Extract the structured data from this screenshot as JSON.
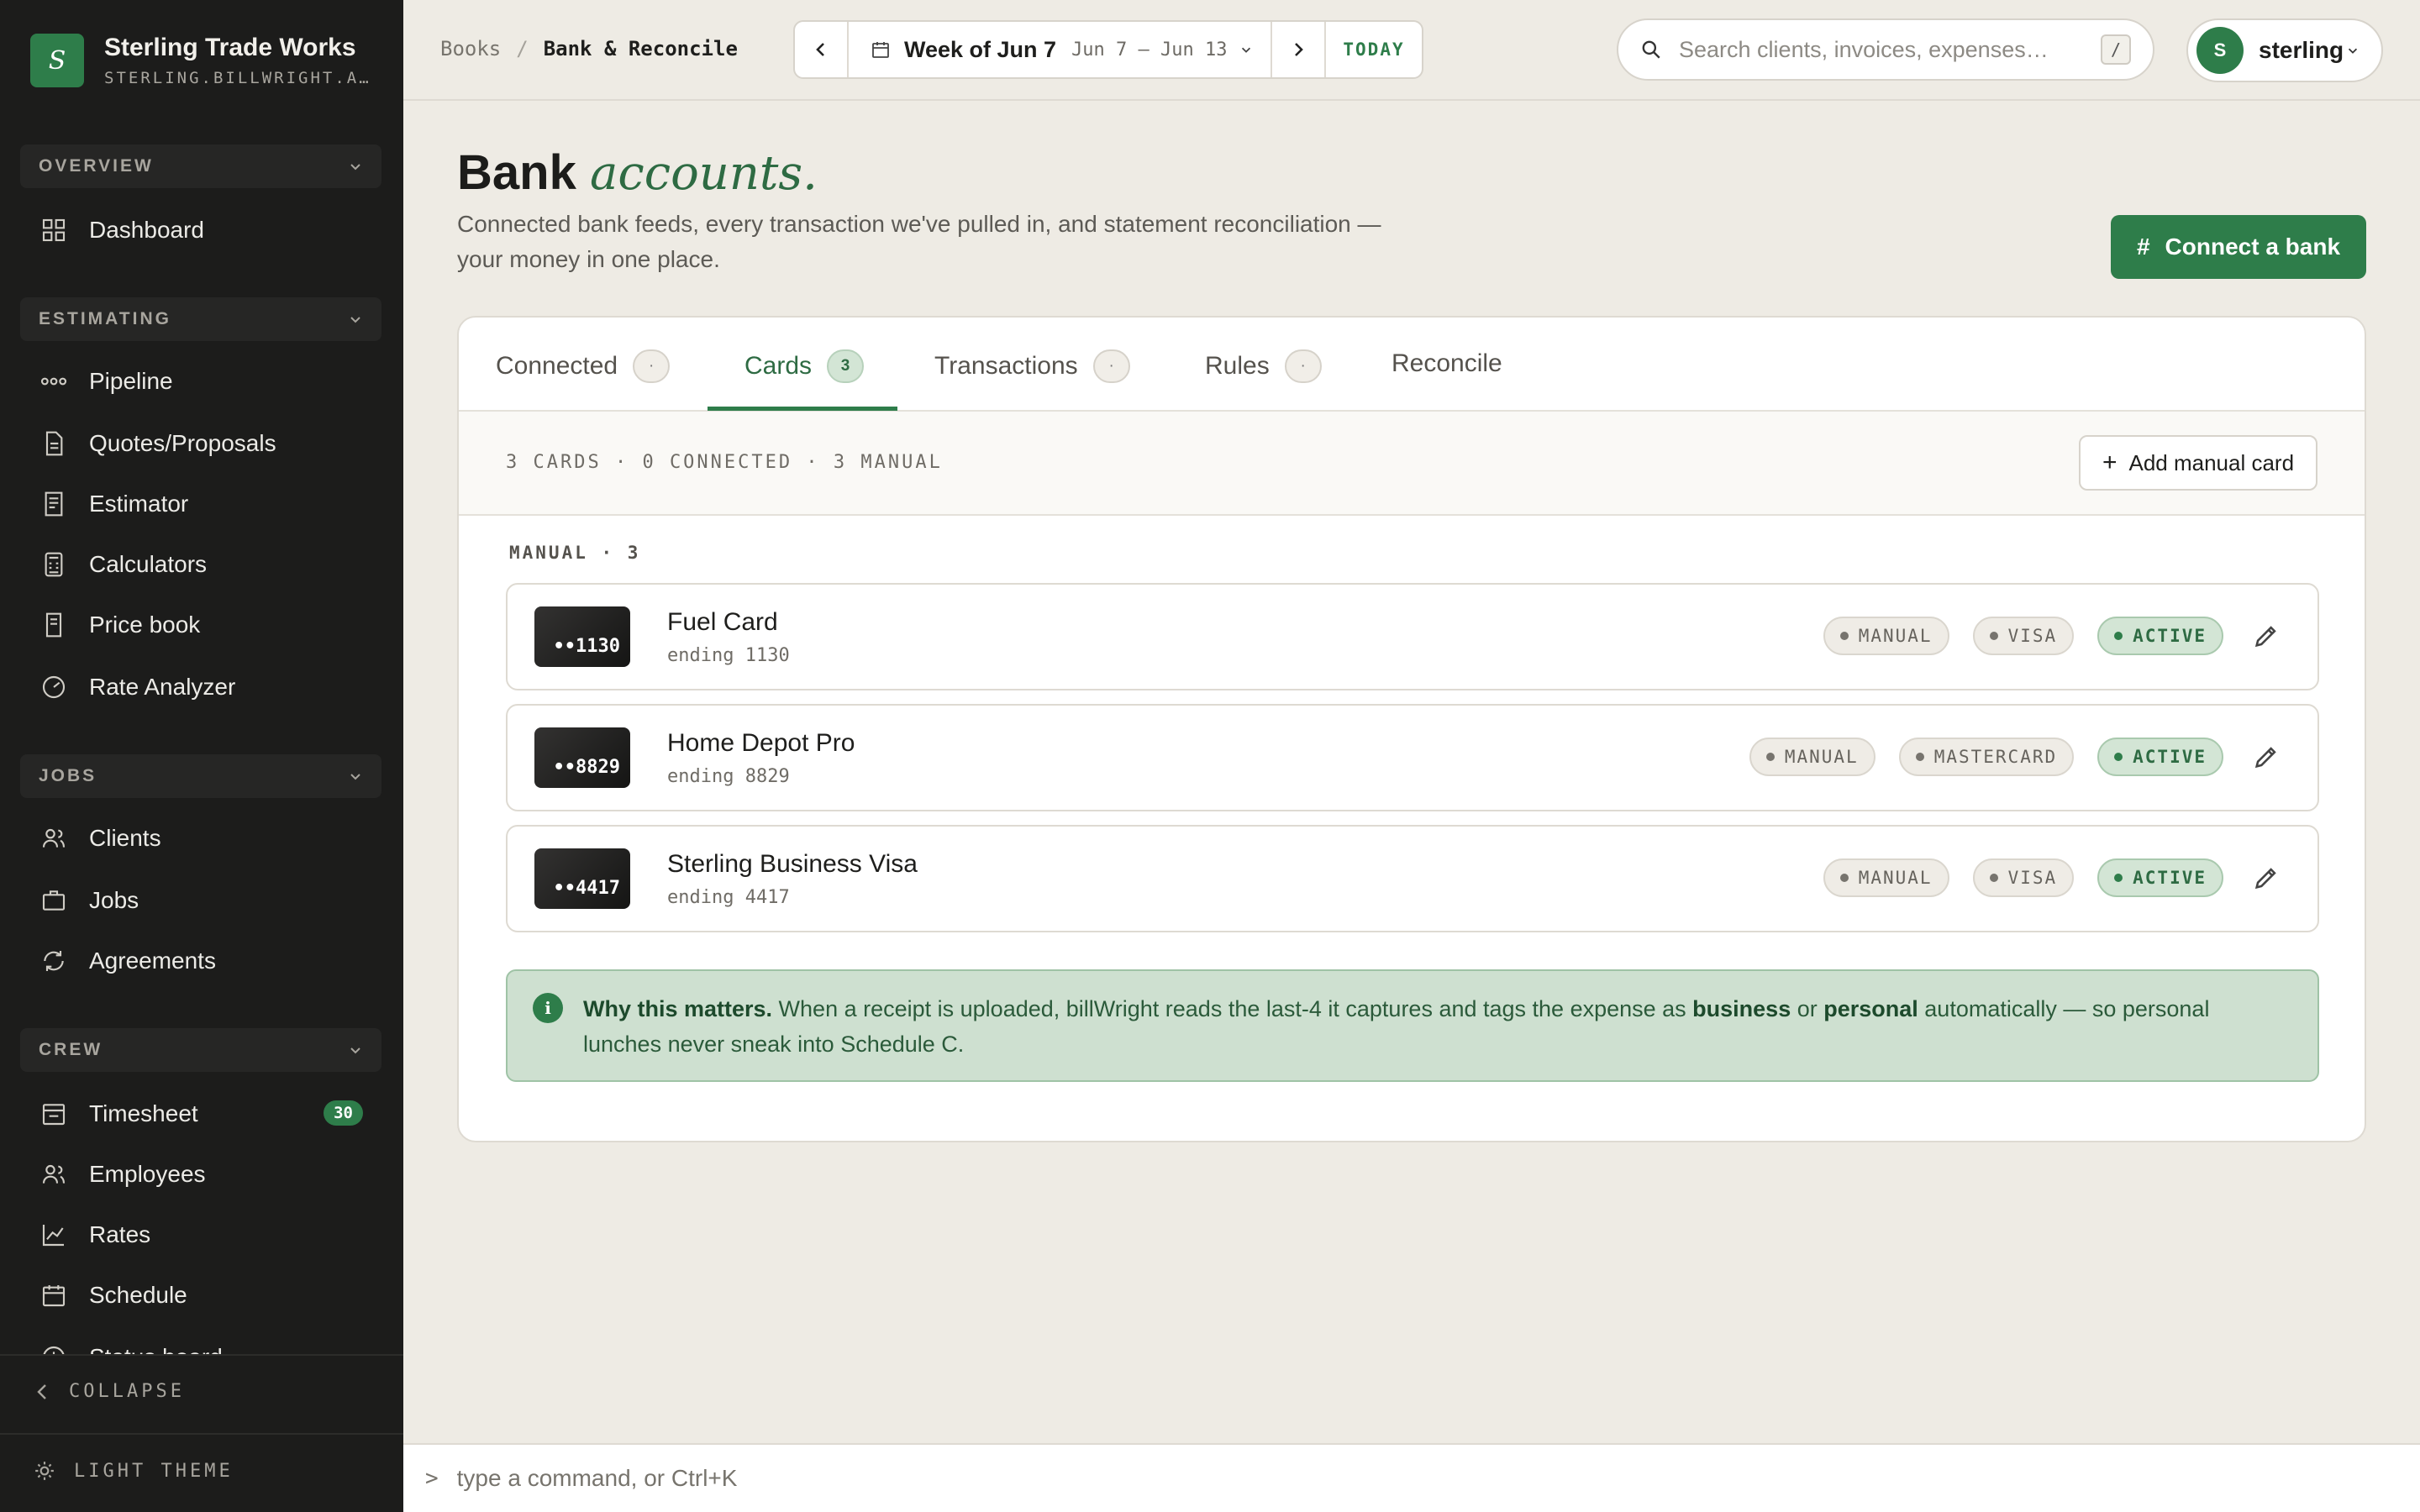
{
  "brand": {
    "logo_letter": "S",
    "name": "Sterling Trade Works",
    "subdomain": "STERLING.BILLWRIGHT.A…"
  },
  "sidebar": {
    "sections": [
      {
        "title": "OVERVIEW",
        "items": [
          {
            "label": "Dashboard",
            "icon": "grid-icon"
          }
        ]
      },
      {
        "title": "ESTIMATING",
        "items": [
          {
            "label": "Pipeline",
            "icon": "pipeline-icon"
          },
          {
            "label": "Quotes/Proposals",
            "icon": "document-icon"
          },
          {
            "label": "Estimator",
            "icon": "document-icon"
          },
          {
            "label": "Calculators",
            "icon": "calculator-icon"
          },
          {
            "label": "Price book",
            "icon": "book-icon"
          },
          {
            "label": "Rate Analyzer",
            "icon": "gauge-icon"
          }
        ]
      },
      {
        "title": "JOBS",
        "items": [
          {
            "label": "Clients",
            "icon": "users-icon"
          },
          {
            "label": "Jobs",
            "icon": "briefcase-icon"
          },
          {
            "label": "Agreements",
            "icon": "refresh-icon"
          }
        ]
      },
      {
        "title": "CREW",
        "items": [
          {
            "label": "Timesheet",
            "icon": "timesheet-icon",
            "badge": "30"
          },
          {
            "label": "Employees",
            "icon": "users-icon"
          },
          {
            "label": "Rates",
            "icon": "chart-icon"
          },
          {
            "label": "Schedule",
            "icon": "calendar-icon"
          },
          {
            "label": "Status board",
            "icon": "clock-icon"
          }
        ]
      }
    ],
    "collapse_label": "COLLAPSE",
    "theme_label": "LIGHT THEME"
  },
  "topbar": {
    "breadcrumb": [
      "Books",
      "Bank & Reconcile"
    ],
    "breadcrumb_sep": "/",
    "week_title": "Week of Jun 7",
    "week_range": "Jun 7 – Jun 13",
    "today_label": "TODAY",
    "search_placeholder": "Search clients, invoices, expenses…",
    "search_shortcut": "/",
    "user": {
      "initial": "S",
      "name": "sterling"
    }
  },
  "page": {
    "title_plain": "Bank",
    "title_italic": "accounts.",
    "subtitle": "Connected bank feeds, every transaction we've pulled in, and statement reconciliation — your money in one place.",
    "connect_button": "Connect a bank",
    "connect_icon": "#"
  },
  "tabs": [
    {
      "label": "Connected",
      "count": "·"
    },
    {
      "label": "Cards",
      "count": "3",
      "active": true
    },
    {
      "label": "Transactions",
      "count": "·"
    },
    {
      "label": "Rules",
      "count": "·"
    },
    {
      "label": "Reconcile"
    }
  ],
  "cards_view": {
    "summary": "3 CARDS · 0 CONNECTED · 3 MANUAL",
    "add_button": "Add manual card",
    "group_label": "MANUAL · 3",
    "cards": [
      {
        "chip": "••1130",
        "name": "Fuel Card",
        "ending": "ending 1130",
        "tags": [
          "MANUAL",
          "VISA"
        ],
        "status": "ACTIVE"
      },
      {
        "chip": "••8829",
        "name": "Home Depot Pro",
        "ending": "ending 8829",
        "tags": [
          "MANUAL",
          "MASTERCARD"
        ],
        "status": "ACTIVE"
      },
      {
        "chip": "••4417",
        "name": "Sterling Business Visa",
        "ending": "ending 4417",
        "tags": [
          "MANUAL",
          "VISA"
        ],
        "status": "ACTIVE"
      }
    ],
    "notice": {
      "icon": "i",
      "lead": "Why this matters.",
      "text1": " When a receipt is uploaded, billWright reads the last-4 it captures and tags the expense as ",
      "bold1": "business",
      "text2": " or ",
      "bold2": "personal",
      "text3": " automatically — so personal lunches never sneak into Schedule C."
    }
  },
  "command_bar": {
    "prompt": ">",
    "placeholder": "type a command, or Ctrl+K"
  },
  "colors": {
    "accent": "#2e7d4a",
    "sidebar_bg": "#1c1c1b",
    "page_bg": "#eeebe4"
  }
}
